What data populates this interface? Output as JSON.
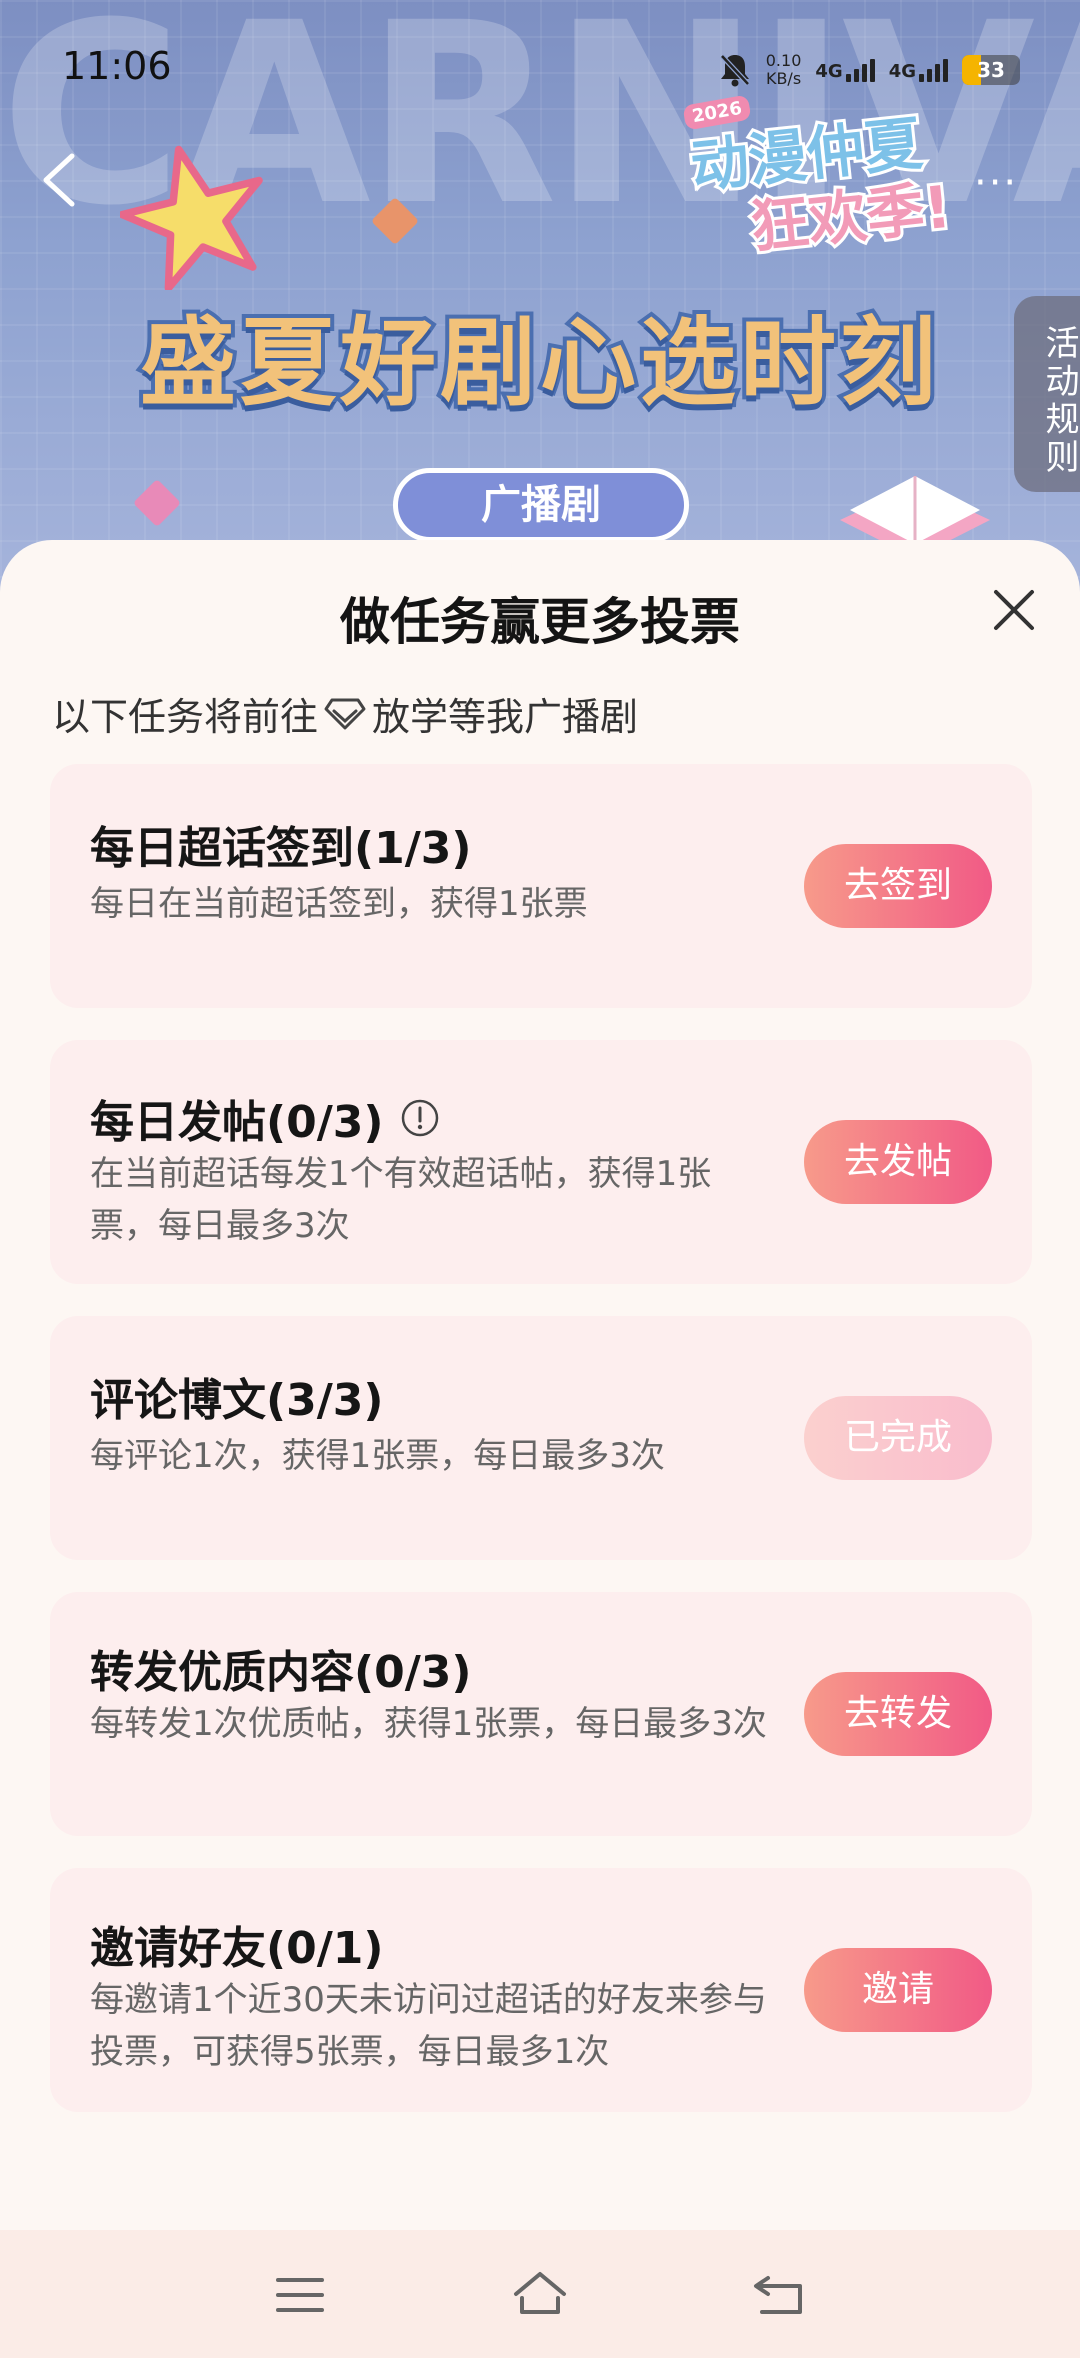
{
  "status_bar": {
    "time": "11:06",
    "net_speed_value": "0.10",
    "net_speed_unit": "KB/s",
    "network_1": "4G",
    "network_2": "4G",
    "battery_level": "33",
    "battery_fraction": 0.33
  },
  "banner": {
    "background_word": "CARNIVAL",
    "event_year": "2026",
    "event_name_line1": "动漫仲夏",
    "event_name_line2": "狂欢季!",
    "headline": "盛夏好剧心选时刻",
    "category": "广播剧",
    "rules_tab": "活动规则"
  },
  "sheet": {
    "title": "做任务赢更多投票",
    "subtitle_prefix": "以下任务将前往",
    "subtitle_target": "放学等我广播剧",
    "tasks": [
      {
        "title": "每日超话签到(1/3)",
        "description": "每日在当前超话签到，获得1张票",
        "button": "去签到",
        "completed": false
      },
      {
        "title": "每日发帖(0/3)",
        "description": "在当前超话每发1个有效超话帖，获得1张票，每日最多3次",
        "button": "去发帖",
        "completed": false
      },
      {
        "title": "评论博文(3/3)",
        "description": "每评论1次，获得1张票，每日最多3次",
        "button": "已完成",
        "completed": true
      },
      {
        "title": "转发优质内容(0/3)",
        "description": "每转发1次优质帖，获得1张票，每日最多3次",
        "button": "去转发",
        "completed": false
      },
      {
        "title": "邀请好友(0/1)",
        "description": "每邀请1个近30天未访问过超话的好友来参与投票，可获得5张票，每日最多1次",
        "button": "邀请",
        "completed": false
      }
    ]
  },
  "colors": {
    "button_gradient_start": "#f79a8a",
    "button_gradient_end": "#f15a86",
    "card_background": "#fdeeee",
    "sheet_background": "#fdf7f3"
  },
  "icons": {
    "back": "chevron-left-icon",
    "more": "more-dots-icon",
    "close": "close-icon",
    "info": "info-circle-icon",
    "supertopic": "diamond-icon",
    "nav_menu": "menu-icon",
    "nav_home": "home-icon",
    "nav_back": "back-icon"
  }
}
